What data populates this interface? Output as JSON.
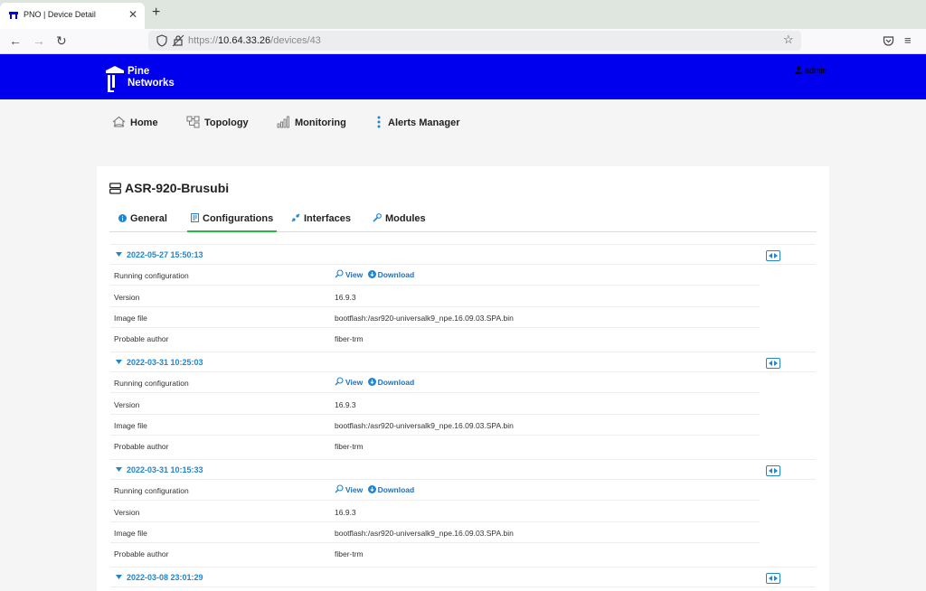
{
  "browser": {
    "tab_title": "PNO | Device Detail",
    "url_scheme": "https://",
    "url_host": "10.64.33.26",
    "url_path": "/devices/43"
  },
  "header": {
    "brand_line1": "Pine",
    "brand_line2": "Networks",
    "user": "admin",
    "bg_color": "#0000ee"
  },
  "menu": [
    {
      "label": "Home",
      "icon": "home-icon"
    },
    {
      "label": "Topology",
      "icon": "topology-icon"
    },
    {
      "label": "Monitoring",
      "icon": "monitoring-icon"
    },
    {
      "label": "Alerts Manager",
      "icon": "alerts-icon"
    }
  ],
  "device": {
    "name": "ASR-920-Brusubi"
  },
  "tabs": [
    {
      "label": "General",
      "icon": "info-icon",
      "active": false
    },
    {
      "label": "Configurations",
      "icon": "config-icon",
      "active": true
    },
    {
      "label": "Interfaces",
      "icon": "interfaces-icon",
      "active": false
    },
    {
      "label": "Modules",
      "icon": "wrench-icon",
      "active": false
    }
  ],
  "labels": {
    "running_config": "Running configuration",
    "version": "Version",
    "image_file": "Image file",
    "probable_author": "Probable author",
    "view": "View",
    "download": "Download"
  },
  "configurations": [
    {
      "date": "2022-05-27 15:50:13",
      "version": "16.9.3",
      "image_file": "bootflash:/asr920-universalk9_npe.16.09.03.SPA.bin",
      "author": "fiber-trm"
    },
    {
      "date": "2022-03-31 10:25:03",
      "version": "16.9.3",
      "image_file": "bootflash:/asr920-universalk9_npe.16.09.03.SPA.bin",
      "author": "fiber-trm"
    },
    {
      "date": "2022-03-31 10:15:33",
      "version": "16.9.3",
      "image_file": "bootflash:/asr920-universalk9_npe.16.09.03.SPA.bin",
      "author": "fiber-trm"
    },
    {
      "date": "2022-03-08 23:01:29"
    }
  ],
  "colors": {
    "link": "#1e70bf",
    "active_tab": "#21ba45"
  }
}
